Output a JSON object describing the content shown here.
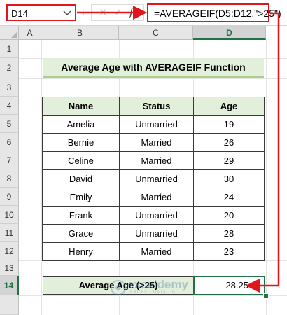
{
  "formula_bar": {
    "name_box": "D14",
    "separator": ":",
    "cancel_glyph": "✕",
    "enter_glyph": "✓",
    "fx_label": "fx",
    "formula": "=AVERAGEIF(D5:D12,\">25\")"
  },
  "columns": [
    "A",
    "B",
    "C",
    "D"
  ],
  "rows": [
    "1",
    "2",
    "3",
    "4",
    "5",
    "6",
    "7",
    "8",
    "9",
    "10",
    "11",
    "12",
    "13",
    "14"
  ],
  "selected_cell": "D14",
  "sheet": {
    "title": "Average Age with AVERAGEIF Function",
    "headers": {
      "name": "Name",
      "status": "Status",
      "age": "Age"
    },
    "records": [
      {
        "name": "Amelia",
        "status": "Unmarried",
        "age": "19"
      },
      {
        "name": "Bernie",
        "status": "Married",
        "age": "26"
      },
      {
        "name": "Celine",
        "status": "Married",
        "age": "29"
      },
      {
        "name": "David",
        "status": "Unmarried",
        "age": "30"
      },
      {
        "name": "Emily",
        "status": "Married",
        "age": "24"
      },
      {
        "name": "Frank",
        "status": "Unmarried",
        "age": "20"
      },
      {
        "name": "Grace",
        "status": "Unmarried",
        "age": "28"
      },
      {
        "name": "Henry",
        "status": "Married",
        "age": "23"
      }
    ],
    "average_label": "Average Age (>25)",
    "average_value": "28.25"
  },
  "watermark": {
    "name": "exceldemy",
    "tagline": "EXCEL · DATA · BI"
  },
  "colors": {
    "annotation_red": "#e0161d",
    "header_fill": "#e2efda",
    "selection_green": "#217346"
  }
}
